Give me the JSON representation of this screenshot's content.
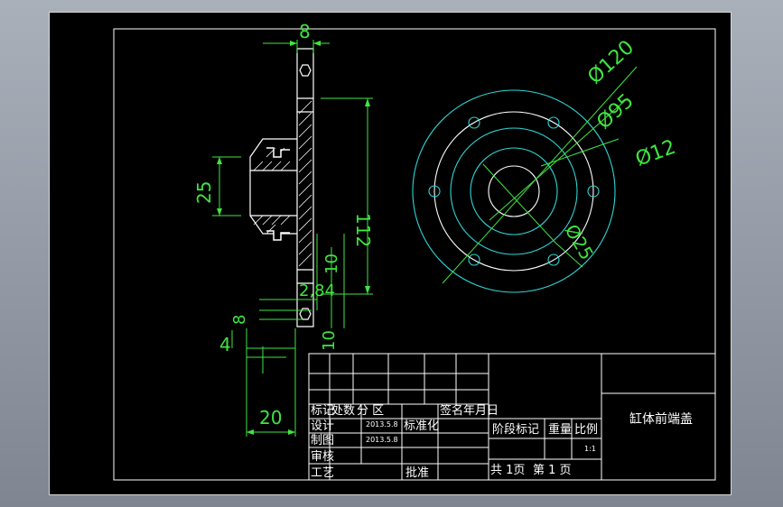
{
  "drawing": {
    "title": "缸体前端盖",
    "dims": {
      "top_width": "8",
      "height_112": "112",
      "bore_25": "25",
      "dim_10a": "10",
      "dim_2_84": "2,84",
      "dim_8": "8",
      "dim_4": "4",
      "dim_10b": "10",
      "dim_20": "20",
      "dia_120": "Ø120",
      "dia_95": "Ø95",
      "dia_12": "Ø12",
      "dia_25": "Ø25"
    }
  },
  "title_block": {
    "row_labels": {
      "mark": "标记",
      "count": "处数",
      "zone": "分 区",
      "sign": "签名",
      "date": "年月日"
    },
    "design": "设计",
    "design_date": "2013.5.8",
    "standardize": "标准化",
    "drawing": "制图",
    "drawing_date": "2013.5.8",
    "review": "审核",
    "process": "工艺",
    "approve": "批准",
    "stage_mark": "阶段标记",
    "weight": "重量",
    "scale": "比例",
    "scale_value": "1:1",
    "sheets_total": "共 1页",
    "sheet_no": "第 1 页"
  },
  "colors": {
    "background": "#000000",
    "dimension": "#3fe63f",
    "outline": "#ffffff",
    "circles": "#2fd6d6"
  }
}
